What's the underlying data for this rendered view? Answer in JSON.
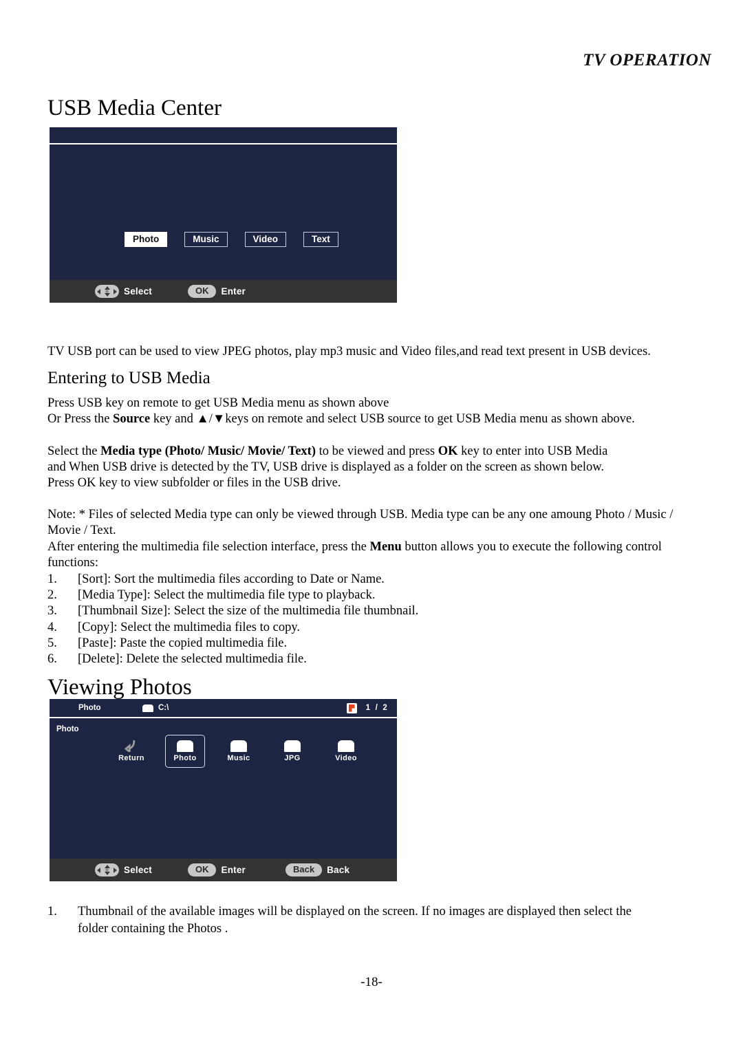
{
  "document": {
    "running_head": "TV OPERATION",
    "folio": "-18-"
  },
  "sections": {
    "usb_media_center": {
      "title": "USB Media Center",
      "intro": "TV USB port can be used to view JPEG photos, play mp3 music and Video files,and read text present in USB devices."
    },
    "entering_usb_media": {
      "title": "Entering to USB Media",
      "line1": "Press USB key on remote to get USB Media menu as shown above",
      "line2_a": "Or Press the ",
      "line2_b": "Source",
      "line2_c": " key and ▲/▼keys on remote and select USB source to get USB Media menu as shown above.",
      "p2_a": "Select the ",
      "p2_b": "Media type (Photo/ Music/ Movie/ Text)",
      "p2_c": " to be viewed and press ",
      "p2_d": "OK",
      "p2_e": " key to enter into USB Media",
      "p2_line2": "and When USB drive is detected by the TV, USB drive is displayed as a folder on the screen as shown below.",
      "p2_line3": "Press OK key to view subfolder or files in the USB drive.",
      "note_line1": "Note: * Files of selected Media type can only be viewed through USB. Media type can be any one amoung Photo / Music /",
      "note_line2": "Movie / Text.",
      "menu_a": "After entering the multimedia file selection interface, press the ",
      "menu_b": "Menu",
      "menu_c": " button allows you to execute the following control",
      "menu_d": "functions:",
      "menu_functions": [
        {
          "num": "1.",
          "text": "[Sort]: Sort the multimedia files according to Date or Name."
        },
        {
          "num": "2.",
          "text": "[Media Type]: Select the multimedia file type to playback."
        },
        {
          "num": "3.",
          "text": "[Thumbnail Size]: Select the size of the multimedia file thumbnail."
        },
        {
          "num": "4.",
          "text": "[Copy]: Select the multimedia files to copy."
        },
        {
          "num": "5.",
          "text": "[Paste]: Paste the copied multimedia file."
        },
        {
          "num": "6.",
          "text": "[Delete]: Delete the selected multimedia file."
        }
      ]
    },
    "viewing_photos": {
      "title": "Viewing Photos",
      "note_num": "1.",
      "note_text": "Thumbnail of the available images will be displayed on the screen. If no images are displayed then select the folder containing the Photos ."
    }
  },
  "osd_media_menu": {
    "media_types": [
      {
        "label": "Photo",
        "selected": true
      },
      {
        "label": "Music",
        "selected": false
      },
      {
        "label": "Video",
        "selected": false
      },
      {
        "label": "Text",
        "selected": false
      }
    ],
    "hints": [
      {
        "key_icon": "dpad-icon",
        "key_label": "",
        "label": "Select"
      },
      {
        "key_icon": "ok-key",
        "key_label": "OK",
        "label": "Enter"
      }
    ],
    "colors": {
      "screen_bg": "#1e2542",
      "hintbar_bg": "#333333",
      "key_fill": "#c8c8c8",
      "chip_border": "#c6cbe0"
    }
  },
  "osd_file_browser": {
    "header": {
      "media_type": "Photo",
      "path": "C:\\",
      "page_current": "1",
      "page_sep": "/",
      "page_total": "2"
    },
    "breadcrumb": "Photo",
    "items": [
      {
        "label": "Return",
        "icon": "return-arrow-icon",
        "selected": false
      },
      {
        "label": "Photo",
        "icon": "folder-icon",
        "selected": true
      },
      {
        "label": "Music",
        "icon": "folder-icon",
        "selected": false
      },
      {
        "label": "JPG",
        "icon": "folder-icon",
        "selected": false
      },
      {
        "label": "Video",
        "icon": "folder-icon",
        "selected": false
      }
    ],
    "hints": [
      {
        "key_icon": "dpad-icon",
        "key_label": "",
        "label": "Select"
      },
      {
        "key_icon": "ok-key",
        "key_label": "OK",
        "label": "Enter"
      },
      {
        "key_icon": "back-key",
        "key_label": "Back",
        "label": "Back"
      }
    ],
    "colors": {
      "screen_bg": "#1e2542",
      "hintbar_bg": "#333333",
      "doc_icon_accent": "#e0431a"
    }
  }
}
